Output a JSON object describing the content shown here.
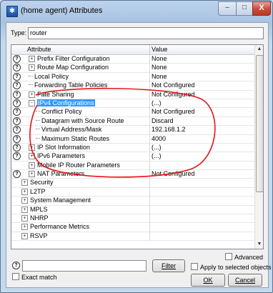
{
  "window": {
    "title": "(home agent) Attributes",
    "icon": "app-icon",
    "controls": {
      "minimize": "–",
      "maximize": "□",
      "close": "X"
    }
  },
  "type": {
    "label": "Type:",
    "value": "router"
  },
  "grid": {
    "columns": {
      "attribute": "Attribute",
      "value": "Value"
    },
    "rows": [
      {
        "help": true,
        "indent": 1,
        "toggle": "+",
        "name": "Prefix Filter Configuration",
        "value": "None"
      },
      {
        "help": true,
        "indent": 1,
        "toggle": "+",
        "name": "Route Map Configuration",
        "value": "None"
      },
      {
        "help": true,
        "indent": 1,
        "toggle": "",
        "name": "Local Policy",
        "value": "None"
      },
      {
        "help": true,
        "indent": 1,
        "toggle": "",
        "name": "Forwarding Table Policies",
        "value": "Not Configured"
      },
      {
        "help": true,
        "indent": 1,
        "toggle": "+",
        "name": "Fate Sharing",
        "value": "Not Configured"
      },
      {
        "help": true,
        "indent": 1,
        "toggle": "-",
        "name": "IPv4 Configurations",
        "value": "(...)",
        "selected": true
      },
      {
        "help": true,
        "indent": 2,
        "toggle": "",
        "name": "Conflict Policy",
        "value": "Not Configured"
      },
      {
        "help": true,
        "indent": 2,
        "toggle": "",
        "name": "Datagram with Source Route",
        "value": "Discard"
      },
      {
        "help": true,
        "indent": 2,
        "toggle": "",
        "name": "Virtual Address/Mask",
        "value": "192.168.1.2"
      },
      {
        "help": true,
        "indent": 2,
        "toggle": "",
        "name": "Maximum Static Routes",
        "value": "4000"
      },
      {
        "help": true,
        "indent": 1,
        "toggle": "+",
        "name": "IP Slot Information",
        "value": "(...)"
      },
      {
        "help": true,
        "indent": 1,
        "toggle": "+",
        "name": "IPv6 Parameters",
        "value": "(...)"
      },
      {
        "help": false,
        "indent": 1,
        "toggle": "+",
        "name": "Mobile IP Router Parameters",
        "value": ""
      },
      {
        "help": true,
        "indent": 1,
        "toggle": "+",
        "name": "NAT Parameters",
        "value": "Not Configured"
      },
      {
        "help": false,
        "indent": 0,
        "toggle": "+",
        "name": "Security",
        "value": ""
      },
      {
        "help": false,
        "indent": 0,
        "toggle": "+",
        "name": "L2TP",
        "value": ""
      },
      {
        "help": false,
        "indent": 0,
        "toggle": "+",
        "name": "System Management",
        "value": ""
      },
      {
        "help": false,
        "indent": 0,
        "toggle": "+",
        "name": "MPLS",
        "value": ""
      },
      {
        "help": false,
        "indent": 0,
        "toggle": "+",
        "name": "NHRP",
        "value": ""
      },
      {
        "help": false,
        "indent": 0,
        "toggle": "+",
        "name": "Performance Metrics",
        "value": ""
      },
      {
        "help": false,
        "indent": 0,
        "toggle": "+",
        "name": "RSVP",
        "value": ""
      }
    ]
  },
  "bottom": {
    "help_icon": "?",
    "filter_value": "",
    "filter_button": "Filter",
    "advanced": "Advanced",
    "apply_selected": "Apply to selected objects",
    "exact_match": "Exact match",
    "ok": "OK",
    "cancel": "Cancel"
  },
  "colors": {
    "annotation": "#e0161b",
    "selection": "#3399ff"
  }
}
